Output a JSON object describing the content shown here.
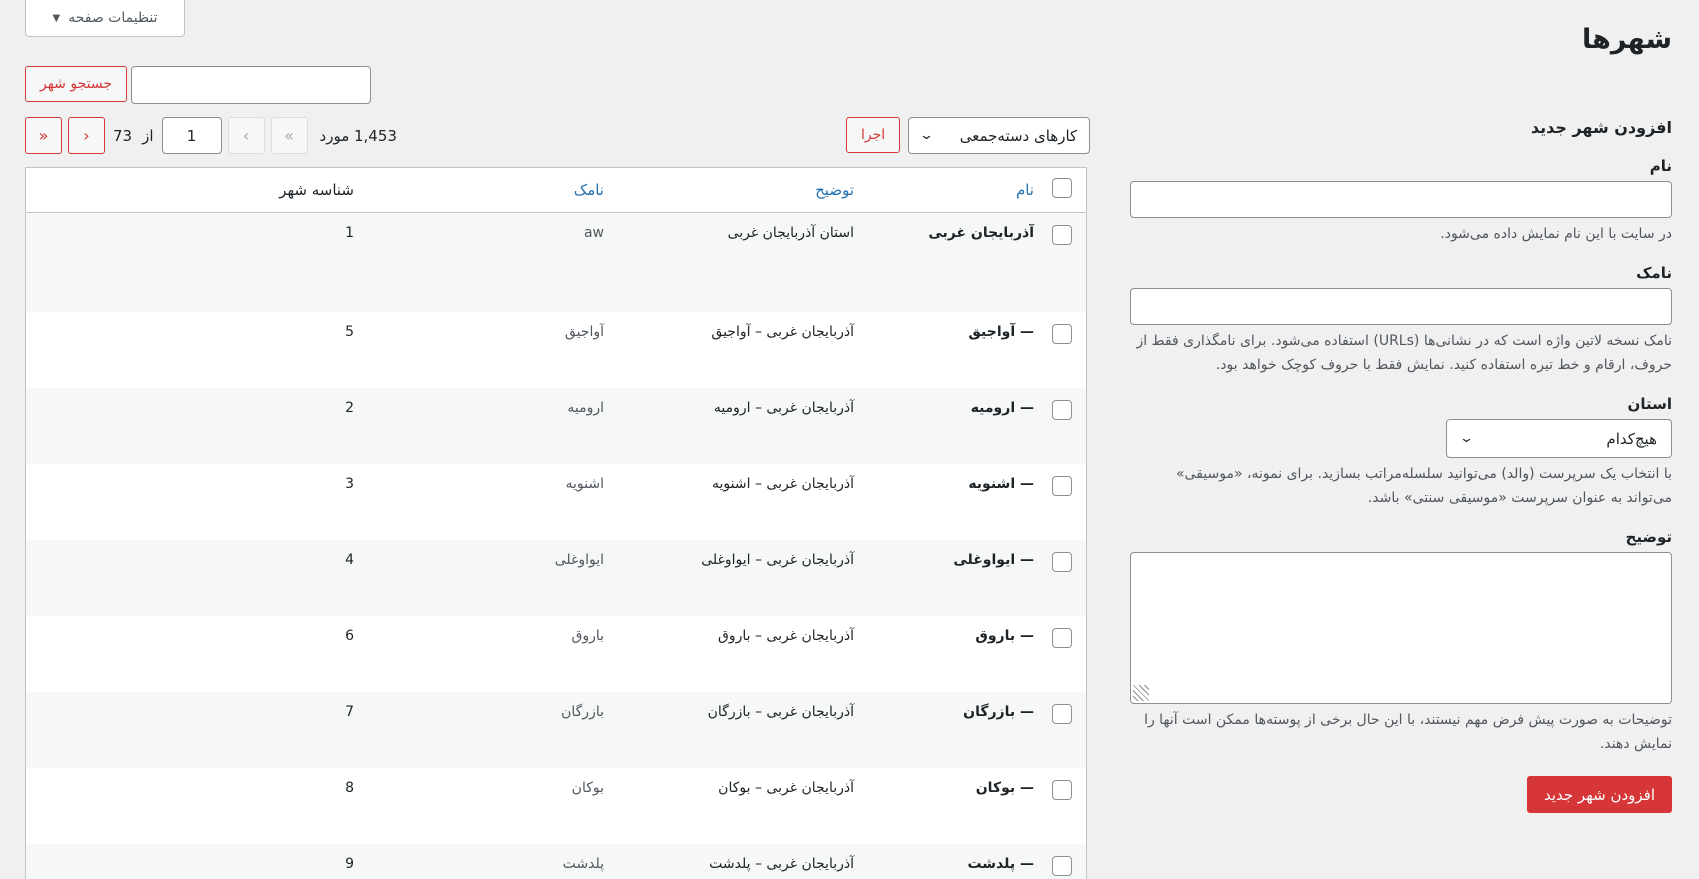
{
  "screen_options": {
    "label": "تنظیمات صفحه"
  },
  "page": {
    "title": "شهرها"
  },
  "search": {
    "button_label": "جستجو شهر",
    "value": ""
  },
  "form": {
    "title": "افزودن شهر جدید",
    "name_label": "نام",
    "name_help": "در سایت با این نام نمایش داده می‌شود.",
    "slug_label": "نامک",
    "slug_help": "نامک نسخه لاتین واژه است که در نشانی‌ها (URLs) استفاده می‌شود. برای نامگذاری فقط از حروف، ارقام و خط تیره استفاده کنید. نمایش فقط با حروف کوچک خواهد بود.",
    "parent_label": "استان",
    "parent_value": "هیچ‌کدام",
    "parent_help": "با انتخاب یک سرپرست (والد) می‌توانید سلسله‌مراتب بسازید. برای نمونه، «موسیقی» می‌تواند به عنوان سرپرست «موسیقی سنتی» باشد.",
    "desc_label": "توضیح",
    "desc_help": "توضیحات به صورت پیش فرض مهم نیستند، با این حال برخی از پوسته‌ها ممکن است آنها را نمایش دهند.",
    "submit_label": "افزودن شهر جدید"
  },
  "tablenav": {
    "bulk_label": "کارهای دسته‌جمعی",
    "apply_label": "اجرا",
    "items_count": "1,453 مورد",
    "first": "«",
    "prev": "‹",
    "current_page": "1",
    "of_label": "از",
    "total_pages": "73",
    "next": "›",
    "last": "»"
  },
  "table": {
    "headers": {
      "name": "نام",
      "description": "توضیح",
      "slug": "نامک",
      "id": "شناسه شهر"
    },
    "rows": [
      {
        "name": "آذربایجان غربی",
        "description": "استان آذربایجان غربی",
        "slug": "aw",
        "id": "1"
      },
      {
        "name": "— آواجیق",
        "description": "آذربایجان غربی – آواجیق",
        "slug": "آواجیق",
        "id": "5"
      },
      {
        "name": "— ارومیه",
        "description": "آذربایجان غربی – ارومیه",
        "slug": "ارومیه",
        "id": "2"
      },
      {
        "name": "— اشنویه",
        "description": "آذربایجان غربی – اشنویه",
        "slug": "اشنویه",
        "id": "3"
      },
      {
        "name": "— ایواوغلی",
        "description": "آذربایجان غربی – ایواوغلی",
        "slug": "ایواوغلی",
        "id": "4"
      },
      {
        "name": "— باروق",
        "description": "آذربایجان غربی – باروق",
        "slug": "باروق",
        "id": "6"
      },
      {
        "name": "— بازرگان",
        "description": "آذربایجان غربی – بازرگان",
        "slug": "بازرگان",
        "id": "7"
      },
      {
        "name": "— بوکان",
        "description": "آذربایجان غربی – بوکان",
        "slug": "بوکان",
        "id": "8"
      },
      {
        "name": "— پلدشت",
        "description": "آذربایجان غربی – پلدشت",
        "slug": "پلدشت",
        "id": "9"
      }
    ]
  }
}
